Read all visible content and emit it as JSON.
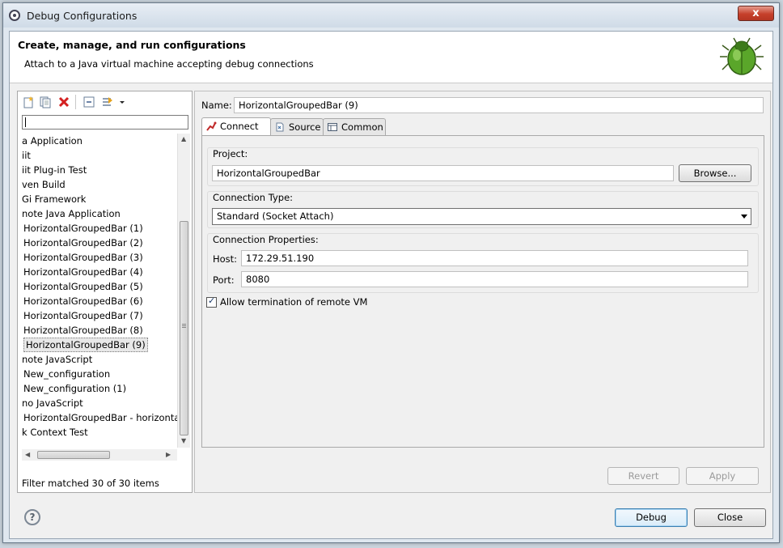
{
  "window": {
    "title": "Debug Configurations",
    "close_glyph": "x"
  },
  "header": {
    "title": "Create, manage, and run configurations",
    "description": "Attach to a Java virtual machine accepting debug connections"
  },
  "left": {
    "toolbar": [
      "new-config-icon",
      "duplicate-icon",
      "delete-icon",
      "collapse-all-icon",
      "filter-icon",
      "dropdown-arrow-icon"
    ],
    "filter_value": "",
    "tree_items": [
      {
        "label": "a Application",
        "indent": 0
      },
      {
        "label": "iit",
        "indent": 0
      },
      {
        "label": "iit Plug-in Test",
        "indent": 0
      },
      {
        "label": "ven Build",
        "indent": 0
      },
      {
        "label": "Gi Framework",
        "indent": 0
      },
      {
        "label": "note Java Application",
        "indent": 0
      },
      {
        "label": "HorizontalGroupedBar (1)",
        "indent": 1
      },
      {
        "label": "HorizontalGroupedBar (2)",
        "indent": 1
      },
      {
        "label": "HorizontalGroupedBar (3)",
        "indent": 1
      },
      {
        "label": "HorizontalGroupedBar (4)",
        "indent": 1
      },
      {
        "label": "HorizontalGroupedBar (5)",
        "indent": 1
      },
      {
        "label": "HorizontalGroupedBar (6)",
        "indent": 1
      },
      {
        "label": "HorizontalGroupedBar (7)",
        "indent": 1
      },
      {
        "label": "HorizontalGroupedBar (8)",
        "indent": 1
      },
      {
        "label": "HorizontalGroupedBar (9)",
        "indent": 1,
        "selected": true
      },
      {
        "label": "note JavaScript",
        "indent": 0
      },
      {
        "label": "New_configuration",
        "indent": 1
      },
      {
        "label": "New_configuration (1)",
        "indent": 1
      },
      {
        "label": "no JavaScript",
        "indent": 0
      },
      {
        "label": "HorizontalGroupedBar - horizontalg",
        "indent": 1
      },
      {
        "label": "k Context Test",
        "indent": 0
      }
    ],
    "filter_status": "Filter matched 30 of 30 items"
  },
  "right": {
    "name_label": "Name:",
    "name_value": "HorizontalGroupedBar (9)",
    "tabs": [
      {
        "label": "Connect",
        "icon": "connect-icon",
        "active": true
      },
      {
        "label": "Source",
        "icon": "source-icon",
        "active": false
      },
      {
        "label": "Common",
        "icon": "common-icon",
        "active": false
      }
    ],
    "project_label": "Project:",
    "project_value": "HorizontalGroupedBar",
    "browse_label": "Browse...",
    "connection_type_label": "Connection Type:",
    "connection_type_value": "Standard (Socket Attach)",
    "connection_props_label": "Connection Properties:",
    "host_label": "Host:",
    "host_value": "172.29.51.190",
    "port_label": "Port:",
    "port_value": "8080",
    "allow_termination_label": "Allow termination of remote VM",
    "allow_termination_checked": true,
    "revert_label": "Revert",
    "apply_label": "Apply"
  },
  "footer": {
    "help_glyph": "?",
    "debug_label": "Debug",
    "close_label": "Close"
  }
}
